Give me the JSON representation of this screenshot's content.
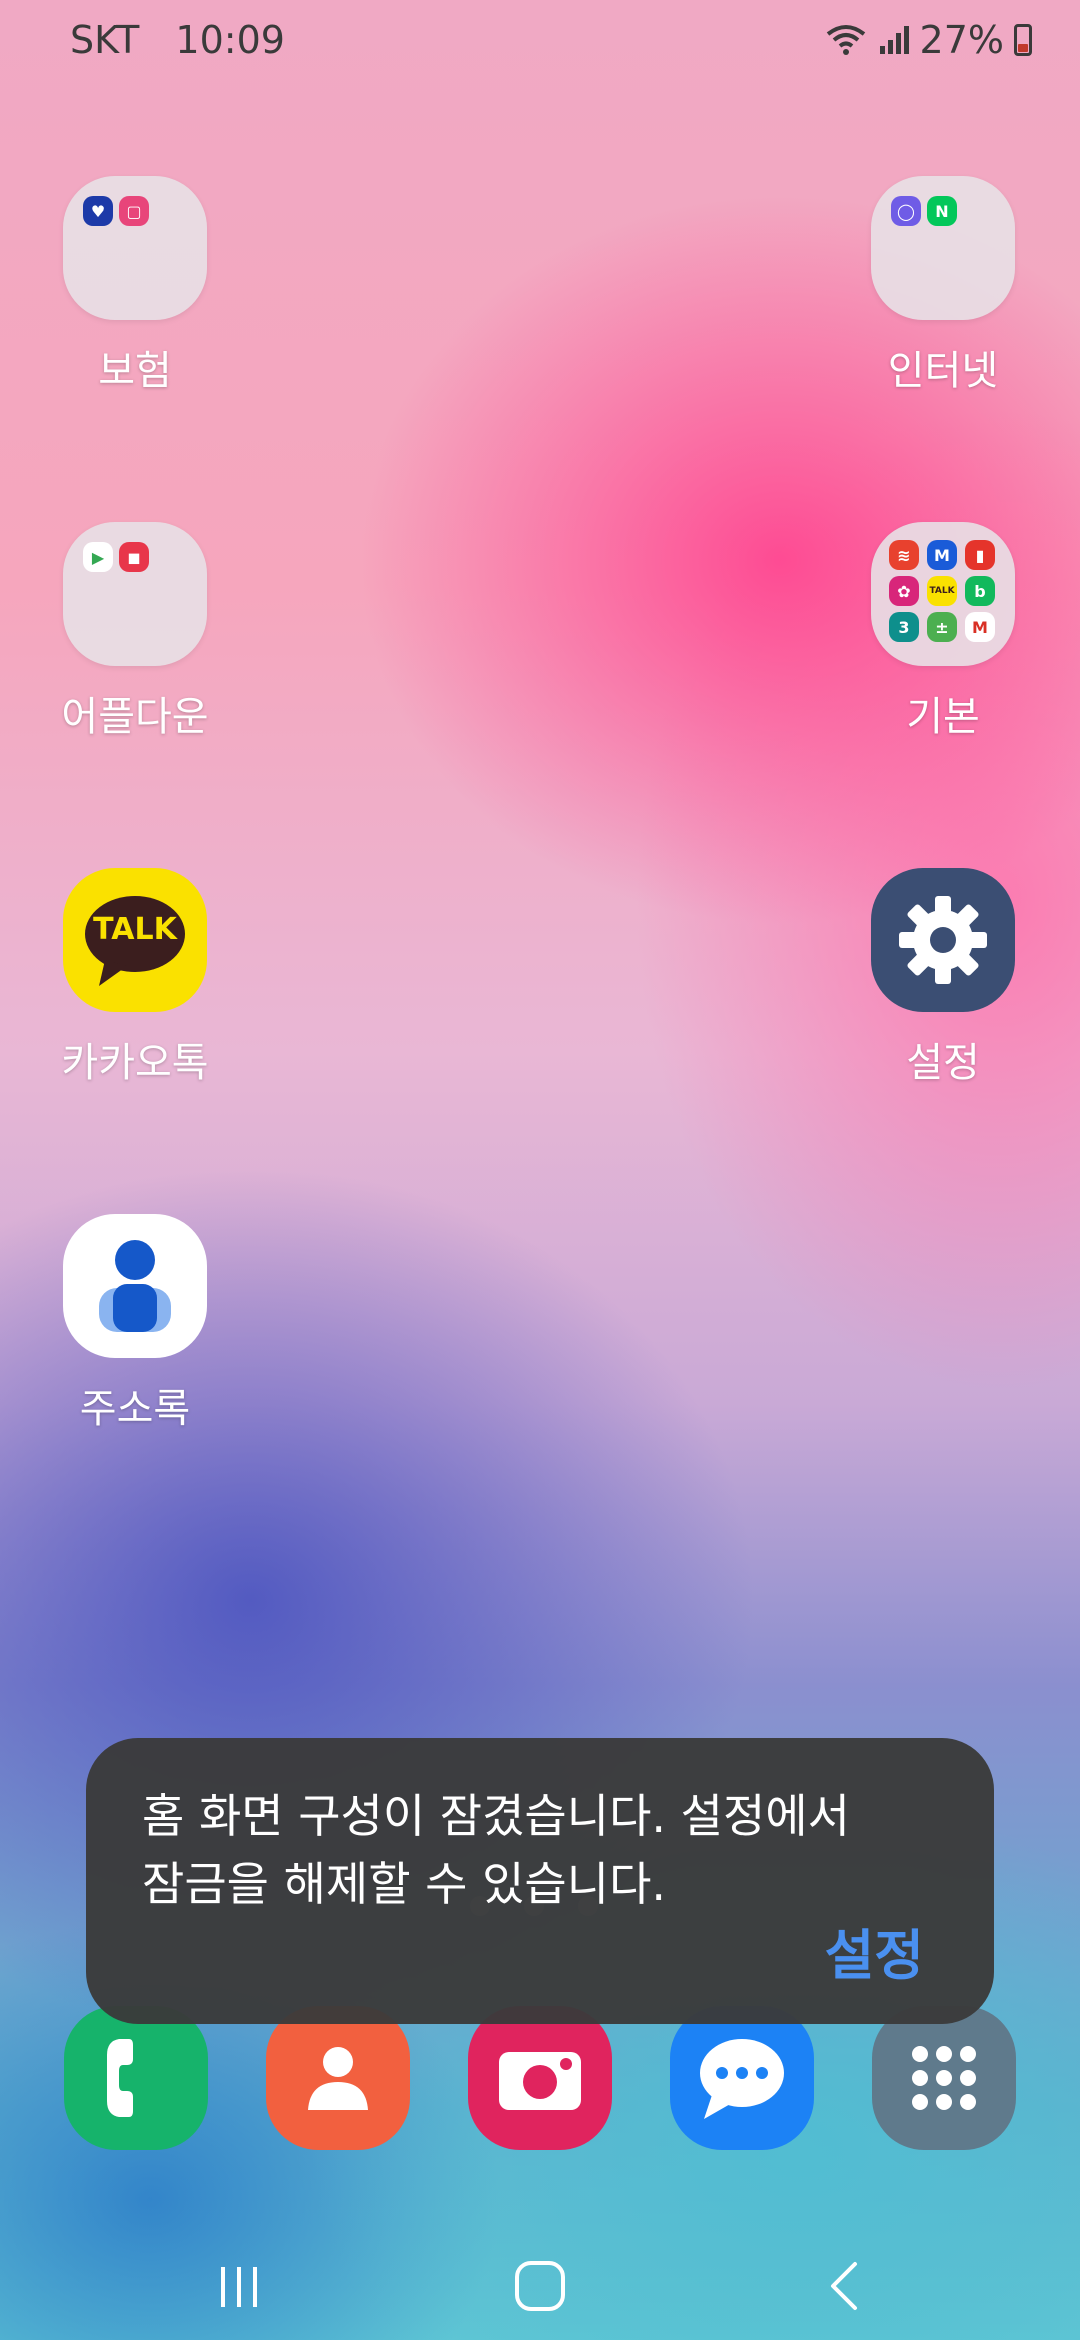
{
  "status_bar": {
    "carrier": "SKT",
    "time": "10:09",
    "battery": "27%"
  },
  "home": {
    "folder_insurance": "보험",
    "folder_internet": "인터넷",
    "folder_appdown": "어플다운",
    "folder_basic": "기본",
    "app_kakaotalk": "카카오톡",
    "app_settings": "설정",
    "app_contacts": "주소록",
    "kakao_talk_text": "TALK"
  },
  "toast": {
    "message_line1": "홈 화면 구성이 잠겼습니다. 설정에서",
    "message_line2": "잠금을 해제할 수 있습니다.",
    "action": "설정"
  },
  "dock": [
    "phone-icon",
    "contacts-icon",
    "camera-icon",
    "messages-icon",
    "app-drawer-icon"
  ],
  "colors": {
    "toast_bg": "#3a3a3a",
    "toast_action": "#4a90f0",
    "kakao_yellow": "#fae100",
    "phone_green": "#16b36b",
    "contacts_orange": "#f2603f",
    "camera_red": "#e0245e",
    "messages_blue": "#1c82f5",
    "drawer_gray": "#5f7a8c",
    "settings_navy": "#3b4e73"
  }
}
